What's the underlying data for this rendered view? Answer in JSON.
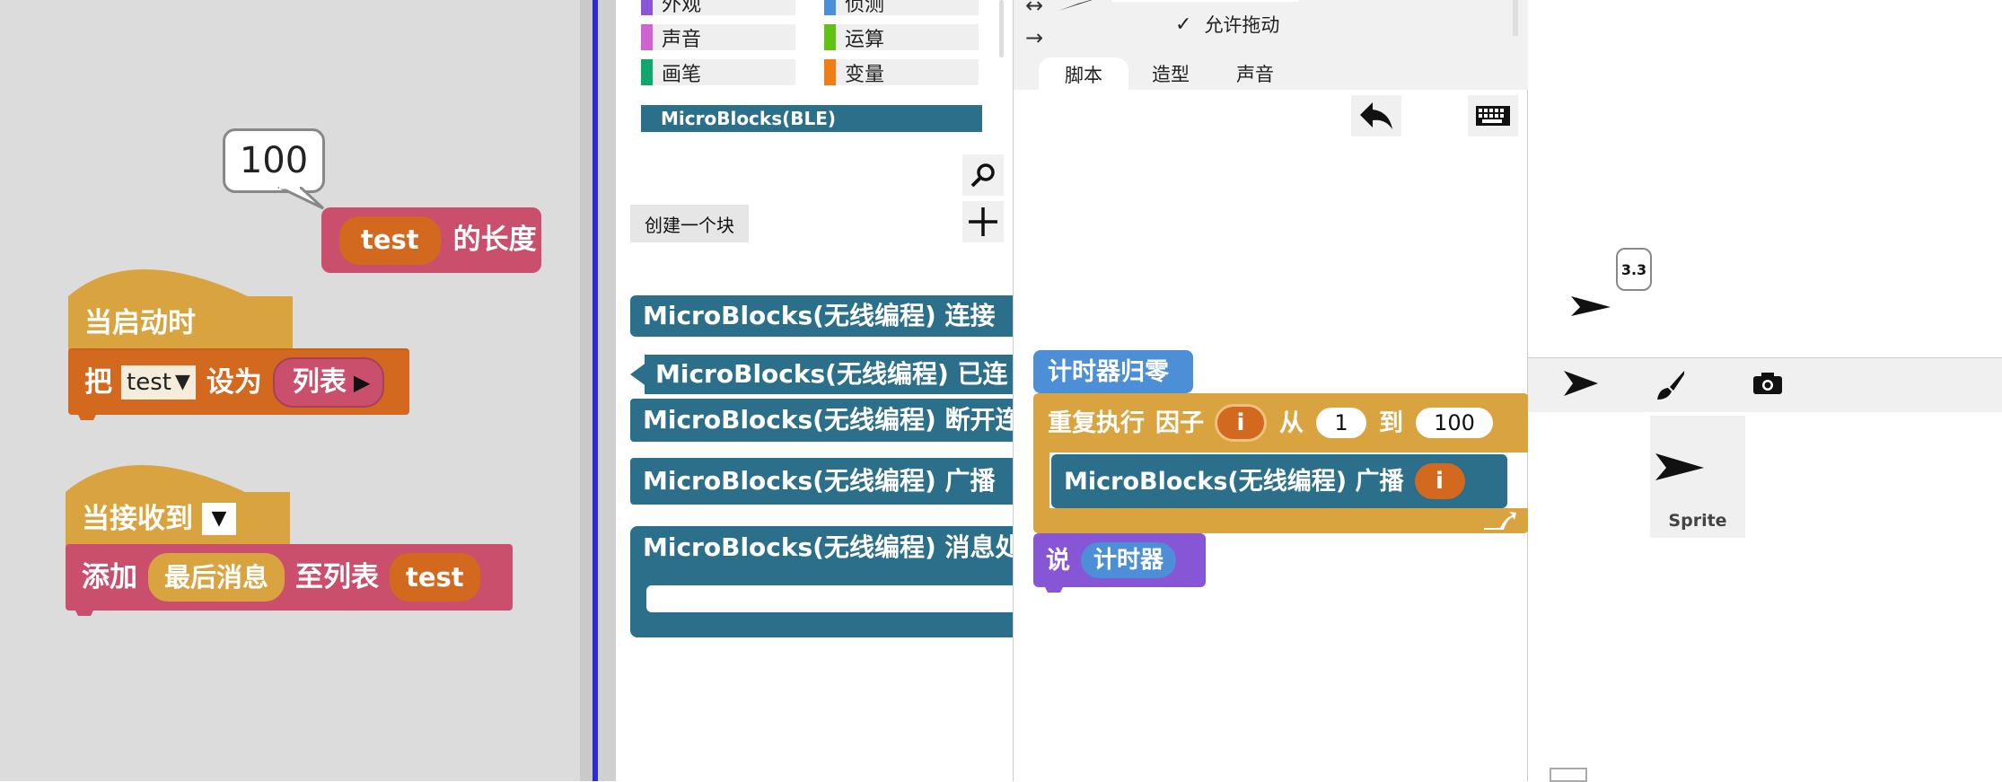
{
  "left_script": {
    "speech_value": "100",
    "length_block": {
      "var": "test",
      "label": "的长度"
    },
    "hat1": {
      "label": "当启动时"
    },
    "set_block": {
      "prefix": "把",
      "var": "test",
      "dropdown_glyph": "▼",
      "middle": "设为",
      "value": "列表",
      "arrow_glyph": "▶"
    },
    "hat2": {
      "label": "当接收到",
      "dropdown_glyph": "▼"
    },
    "add_block": {
      "prefix": "添加",
      "item": "最后消息",
      "middle": "至列表",
      "list": "test"
    }
  },
  "palette": {
    "categories": [
      {
        "label": "外观",
        "color": "#8a55d7"
      },
      {
        "label": "侦测",
        "color": "#4a90d9"
      },
      {
        "label": "声音",
        "color": "#cf63cf"
      },
      {
        "label": "运算",
        "color": "#62c213"
      },
      {
        "label": "画笔",
        "color": "#0fa66f"
      },
      {
        "label": "变量",
        "color": "#ee7d16"
      }
    ],
    "library_label": "MicroBlocks(BLE)",
    "make_block_label": "创建一个块",
    "blocks": [
      {
        "text": "MicroBlocks(无线编程) 连接"
      },
      {
        "text": "MicroBlocks(无线编程) 已连"
      },
      {
        "text": "MicroBlocks(无线编程) 断开连"
      },
      {
        "text": "MicroBlocks(无线编程) 广播"
      },
      {
        "text": "MicroBlocks(无线编程) 消息处"
      }
    ]
  },
  "sprite_corral_top": {
    "allow_drag_label": "允许拖动",
    "check_glyph": "✓",
    "arrow_lr": "↔",
    "arrow_r": "→"
  },
  "tabs": [
    "脚本",
    "造型",
    "声音"
  ],
  "script_area": {
    "reset_block": "计时器归零",
    "repeat_block": {
      "label": "重复执行",
      "factor_label": "因子",
      "var": "i",
      "from_label": "从",
      "from_value": "1",
      "to_label": "到",
      "to_value": "100"
    },
    "broadcast_block": {
      "label": "MicroBlocks(无线编程) 广播",
      "arg": "i"
    },
    "say_block": {
      "label": "说",
      "arg": "计时器"
    }
  },
  "stage": {
    "bubble_value": "3.3"
  },
  "sprite_tools": {
    "sprite_name": "Sprite"
  },
  "colors": {
    "list_pink": "#c94f6d",
    "var_orange": "#d2691e",
    "control_gold": "#d9a33f",
    "microblocks_teal": "#2b6f8b",
    "sensing_blue": "#4c8fd6",
    "looks_purple": "#8756d6"
  }
}
